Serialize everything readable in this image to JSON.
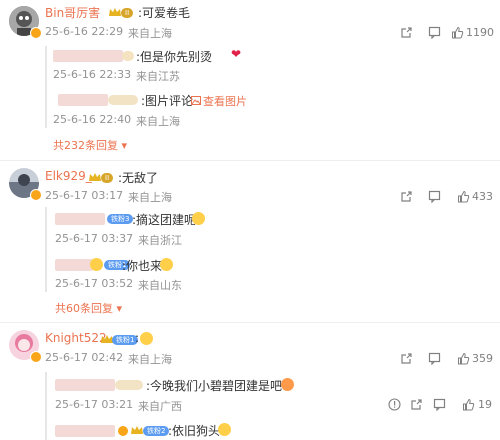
{
  "colors": {
    "accent": "#eb7350",
    "meta": "#939393",
    "badge_gold": "#f9a51a",
    "badge_blue": "#5b9bf0",
    "heart": "#e0224a"
  },
  "comments": [
    {
      "user": "Bin哥厉害",
      "level": "II",
      "text": ":可爱卷毛",
      "date": "25-6-16 22:29",
      "location": "来自上海",
      "likes": "1190",
      "replies": [
        {
          "user": "",
          "text": ":但是你先别烫",
          "date": "25-6-16 22:33",
          "location": "来自江苏"
        },
        {
          "user": "",
          "text": ":图片评论",
          "image_link": "查看图片",
          "date": "25-6-16 22:40",
          "location": "来自上海"
        }
      ],
      "more_replies": "共232条回复"
    },
    {
      "user": "Elk929_",
      "level": "II",
      "text": ":无敌了",
      "date": "25-6-17 03:17",
      "location": "来自上海",
      "likes": "433",
      "replies": [
        {
          "user": "",
          "badge": "铁粉3",
          "text": ":摘这团建呢",
          "date": "25-6-17 03:37",
          "location": "来自浙江"
        },
        {
          "user": "",
          "badge": "铁粉1",
          "text": ":你也来",
          "date": "25-6-17 03:52",
          "location": "来自山东"
        }
      ],
      "more_replies": "共60条回复"
    },
    {
      "user": "Knight522",
      "badge": "铁粉1",
      "text": ":",
      "date": "25-6-17 02:42",
      "location": "来自上海",
      "likes": "359",
      "replies": [
        {
          "user": "",
          "text": ":今晚我们小碧碧团建是吧",
          "date": "25-6-17 03:21",
          "location": "来自广西",
          "likes": "19"
        },
        {
          "user": "",
          "badge": "铁粉2",
          "text": ":依旧狗头",
          "date": "",
          "location": ""
        }
      ]
    }
  ]
}
